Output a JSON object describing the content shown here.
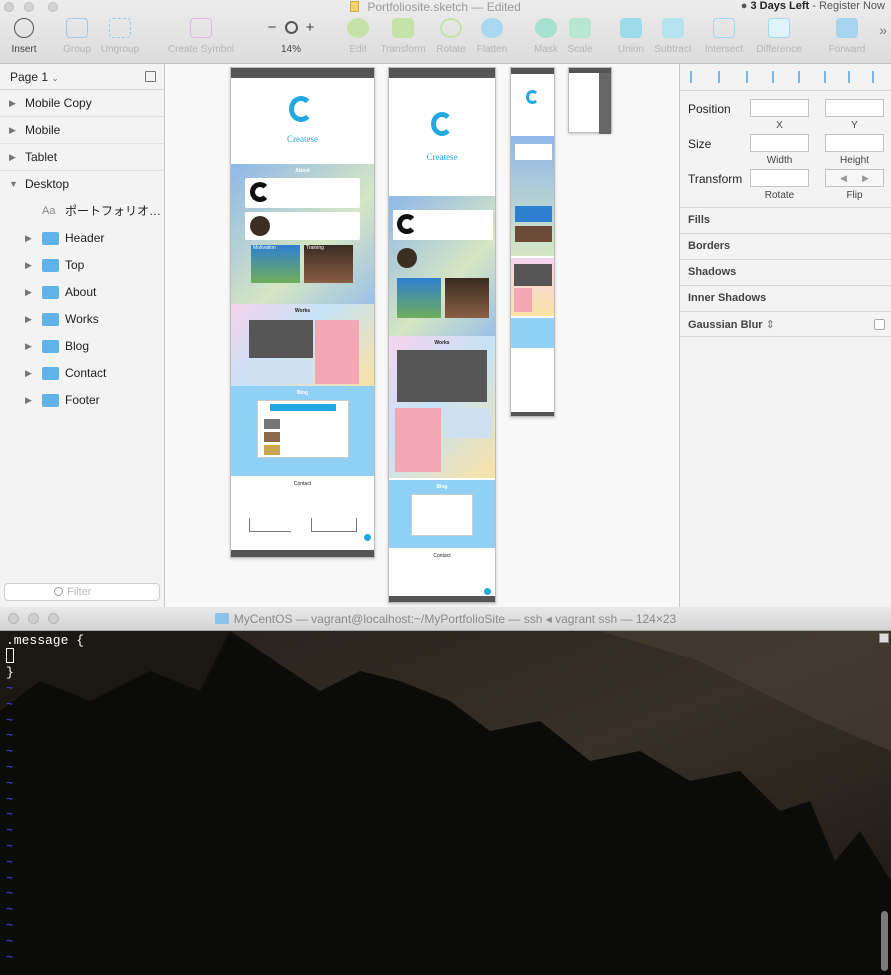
{
  "window": {
    "title": "Portfoliosite.sketch",
    "edited": "— Edited",
    "trial": "3 Days Left",
    "register": "Register Now"
  },
  "toolbar": {
    "insert": "Insert",
    "group": "Group",
    "ungroup": "Ungroup",
    "create_symbol": "Create Symbol",
    "zoom_minus": "−",
    "zoom_plus": "+",
    "zoom": "14%",
    "edit": "Edit",
    "transform": "Transform",
    "rotate": "Rotate",
    "flatten": "Flatten",
    "mask": "Mask",
    "scale": "Scale",
    "union": "Union",
    "subtract": "Subtract",
    "intersect": "Intersect",
    "difference": "Difference",
    "forward": "Forward",
    "more": "»"
  },
  "layers": {
    "page": "Page 1",
    "pages": [
      "Mobile Copy",
      "Mobile",
      "Tablet",
      "Desktop"
    ],
    "text_layer": "ポートフォリオ…",
    "groups": [
      "Header",
      "Top",
      "About",
      "Works",
      "Blog",
      "Contact",
      "Footer"
    ],
    "filter_placeholder": "Filter"
  },
  "artboards": {
    "brand": "Createse",
    "about": "About",
    "works": "Works",
    "blog": "Blog",
    "contact": "Contact",
    "motivation": "Motivation",
    "training": "Training",
    "colors": {
      "accent": "#22a8e0",
      "about_bg": "#9fc4ee",
      "blog_bg": "#8fd0f4"
    }
  },
  "inspector": {
    "position": "Position",
    "x": "X",
    "y": "Y",
    "size": "Size",
    "width": "Width",
    "height": "Height",
    "transform": "Transform",
    "rotate": "Rotate",
    "flip": "Flip",
    "fills": "Fills",
    "borders": "Borders",
    "shadows": "Shadows",
    "inner_shadows": "Inner Shadows",
    "blur": "Gaussian Blur"
  },
  "terminal": {
    "title": "MyCentOS — vagrant@localhost:~/MyPortfolioSite — ssh ◂ vagrant ssh — 124×23",
    "lines": [
      ".message {",
      "",
      "}"
    ],
    "tilde": "~"
  }
}
